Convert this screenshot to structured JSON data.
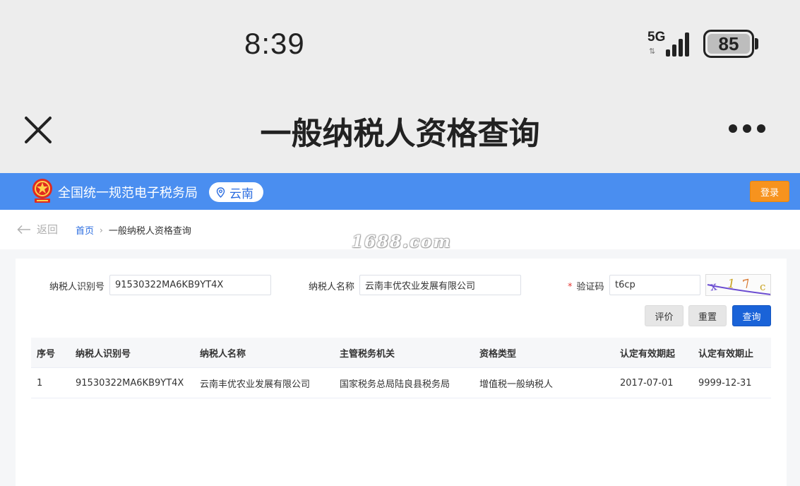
{
  "status": {
    "time": "8:39",
    "network": "5G",
    "battery": "85"
  },
  "appbar": {
    "title": "一般纳税人资格查询"
  },
  "site": {
    "title": "全国统一规范电子税务局",
    "region": "云南",
    "login_label": "登录",
    "brand_color": "#4a8ef0"
  },
  "nav": {
    "back_label": "返回",
    "home_label": "首页",
    "current_label": "一般纳税人资格查询",
    "watermark": "1688.com"
  },
  "form": {
    "taxpayer_id_label": "纳税人识别号",
    "taxpayer_id_value": "91530322MA6KB9YT4X",
    "taxpayer_name_label": "纳税人名称",
    "taxpayer_name_value": "云南丰优农业发展有限公司",
    "captcha_required_mark": "*",
    "captcha_label": "验证码",
    "captcha_value": "t6cp",
    "captcha_image_text": "x17c"
  },
  "buttons": {
    "rate_label": "评价",
    "reset_label": "重置",
    "search_label": "查询"
  },
  "table": {
    "headers": [
      "序号",
      "纳税人识别号",
      "纳税人名称",
      "主管税务机关",
      "资格类型",
      "认定有效期起",
      "认定有效期止"
    ],
    "rows": [
      [
        "1",
        "91530322MA6KB9YT4X",
        "云南丰优农业发展有限公司",
        "国家税务总局陆良县税务局",
        "增值税一般纳税人",
        "2017-07-01",
        "9999-12-31"
      ]
    ]
  }
}
